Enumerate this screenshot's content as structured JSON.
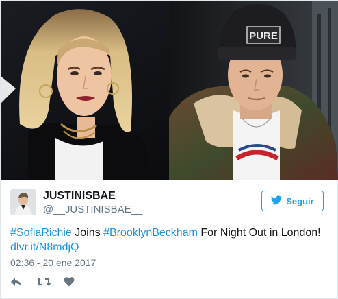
{
  "tweet": {
    "display_name": "JUSTINISBAE",
    "handle": "@__JUSTINISBAE__",
    "follow_label": "Seguir",
    "text_parts": {
      "hashtag1": "#SofiaRichie",
      "middle1": " Joins ",
      "hashtag2": "#BrooklynBeckham",
      "middle2": " For Night Out in London!",
      "link": "dlvr.it/N8mdjQ"
    },
    "timestamp": "02:36 - 20 ene 2017",
    "beanie_text": "PURE"
  },
  "icons": {
    "follow": "bird-icon",
    "reply": "reply-icon",
    "retweet": "retweet-icon",
    "like": "heart-icon"
  },
  "colors": {
    "accent": "#1da1f2",
    "link": "#1b95e0",
    "muted": "#657786",
    "action_icon": "#66757f"
  }
}
